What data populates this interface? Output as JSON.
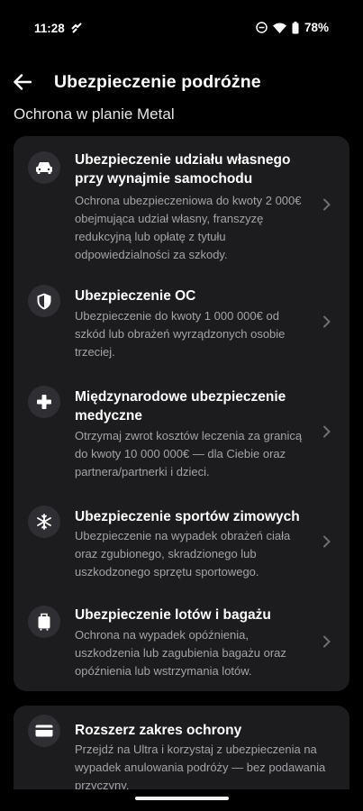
{
  "status": {
    "time": "11:28",
    "battery": "78%"
  },
  "header": {
    "title": "Ubezpieczenie podróżne"
  },
  "section": {
    "title": "Ochrona w planie Metal"
  },
  "items": [
    {
      "icon": "car-icon",
      "title": "Ubezpieczenie udziału własnego przy wynajmie samochodu",
      "desc": "Ochrona ubezpieczeniowa do kwoty 2 000€ obejmująca udział własny, franszyzę redukcyjną lub opłatę z tytułu odpowiedzialności za szkody."
    },
    {
      "icon": "shield-icon",
      "title": "Ubezpieczenie OC",
      "desc": "Ubezpieczenie do kwoty 1 000 000€ od szkód lub obrażeń wyrządzonych osobie trzeciej."
    },
    {
      "icon": "medical-cross-icon",
      "title": "Międzynarodowe ubezpieczenie medyczne",
      "desc": "Otrzymaj zwrot kosztów leczenia za granicą do kwoty 10 000 000€ — dla Ciebie oraz partnera/partnerki i dzieci."
    },
    {
      "icon": "snowflake-icon",
      "title": "Ubezpieczenie sportów zimowych",
      "desc": "Ubezpieczenie na wypadek obrażeń ciała oraz zgubionego, skradzionego lub uszkodzonego sprzętu sportowego."
    },
    {
      "icon": "luggage-icon",
      "title": "Ubezpieczenie lotów i bagażu",
      "desc": "Ochrona na wypadek opóźnienia, uszkodzenia lub zagubienia bagażu oraz opóźnienia lub wstrzymania lotów."
    }
  ],
  "extra": {
    "icon": "card-icon",
    "title": "Rozszerz zakres ochrony",
    "desc": "Przejdź na Ultra i korzystaj z ubezpieczenia na wypadek anulowania podróży — bez podawania przyczyny."
  }
}
